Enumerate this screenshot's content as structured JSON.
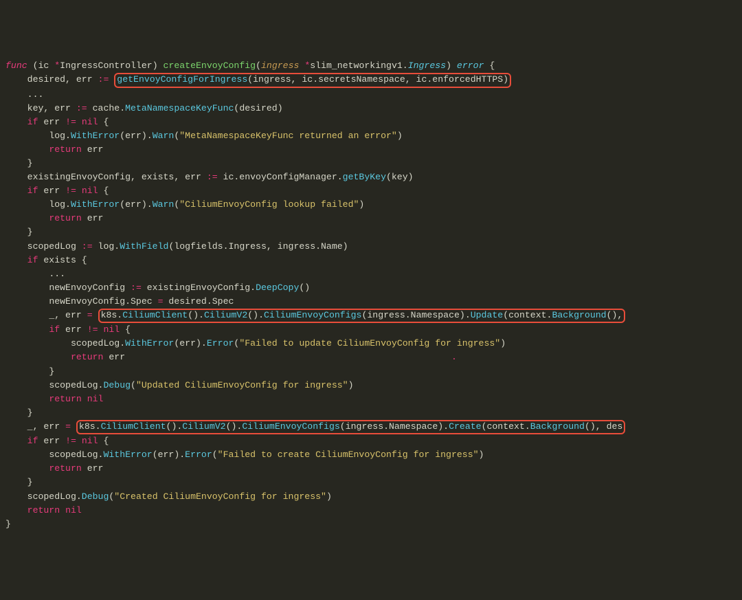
{
  "code": {
    "lines": [
      {
        "indent": 0,
        "segs": [
          {
            "t": "func ",
            "c": "kw"
          },
          {
            "t": "(ic "
          },
          {
            "t": "*",
            "c": "kwni"
          },
          {
            "t": "IngressController) "
          },
          {
            "t": "createEnvoyConfig",
            "c": "fn"
          },
          {
            "t": "("
          },
          {
            "t": "ingress ",
            "c": "arg"
          },
          {
            "t": "*",
            "c": "kwni"
          },
          {
            "t": "slim_networkingv1."
          },
          {
            "t": "Ingress",
            "c": "type"
          },
          {
            "t": ") "
          },
          {
            "t": "error",
            "c": "type"
          },
          {
            "t": " {"
          }
        ]
      },
      {
        "indent": 1,
        "segs": [
          {
            "t": "desired, err "
          },
          {
            "t": ":=",
            "c": "kwni"
          },
          {
            "t": " "
          },
          {
            "hl": true,
            "segs": [
              {
                "t": "getEnvoyConfigForIngress",
                "c": "call"
              },
              {
                "t": "(ingress, ic.secretsNamespace, ic.enforcedHTTPS)"
              }
            ]
          }
        ]
      },
      {
        "indent": 1,
        "segs": [
          {
            "t": "..."
          }
        ]
      },
      {
        "indent": 1,
        "segs": [
          {
            "t": "key, err "
          },
          {
            "t": ":=",
            "c": "kwni"
          },
          {
            "t": " cache."
          },
          {
            "t": "MetaNamespaceKeyFunc",
            "c": "call"
          },
          {
            "t": "(desired)"
          }
        ]
      },
      {
        "indent": 1,
        "segs": [
          {
            "t": "if",
            "c": "kwni"
          },
          {
            "t": " err "
          },
          {
            "t": "!=",
            "c": "kwni"
          },
          {
            "t": " "
          },
          {
            "t": "nil",
            "c": "kwni"
          },
          {
            "t": " {"
          }
        ]
      },
      {
        "indent": 2,
        "segs": [
          {
            "t": "log."
          },
          {
            "t": "WithError",
            "c": "call"
          },
          {
            "t": "(err)."
          },
          {
            "t": "Warn",
            "c": "call"
          },
          {
            "t": "("
          },
          {
            "t": "\"MetaNamespaceKeyFunc returned an error\"",
            "c": "str"
          },
          {
            "t": ")"
          }
        ]
      },
      {
        "indent": 2,
        "segs": [
          {
            "t": "return",
            "c": "kwni"
          },
          {
            "t": " err"
          }
        ]
      },
      {
        "indent": 1,
        "segs": [
          {
            "t": "}"
          }
        ]
      },
      {
        "indent": 1,
        "segs": [
          {
            "t": "existingEnvoyConfig, exists, err "
          },
          {
            "t": ":=",
            "c": "kwni"
          },
          {
            "t": " ic.envoyConfigManager."
          },
          {
            "t": "getByKey",
            "c": "call"
          },
          {
            "t": "(key)"
          }
        ]
      },
      {
        "indent": 1,
        "segs": [
          {
            "t": "if",
            "c": "kwni"
          },
          {
            "t": " err "
          },
          {
            "t": "!=",
            "c": "kwni"
          },
          {
            "t": " "
          },
          {
            "t": "nil",
            "c": "kwni"
          },
          {
            "t": " {"
          }
        ]
      },
      {
        "indent": 2,
        "segs": [
          {
            "t": "log."
          },
          {
            "t": "WithError",
            "c": "call"
          },
          {
            "t": "(err)."
          },
          {
            "t": "Warn",
            "c": "call"
          },
          {
            "t": "("
          },
          {
            "t": "\"CiliumEnvoyConfig lookup failed\"",
            "c": "str"
          },
          {
            "t": ")"
          }
        ]
      },
      {
        "indent": 2,
        "segs": [
          {
            "t": "return",
            "c": "kwni"
          },
          {
            "t": " err"
          }
        ]
      },
      {
        "indent": 1,
        "segs": [
          {
            "t": "}"
          }
        ]
      },
      {
        "indent": 0,
        "segs": [
          {
            "t": ""
          }
        ]
      },
      {
        "indent": 1,
        "segs": [
          {
            "t": "scopedLog "
          },
          {
            "t": ":=",
            "c": "kwni"
          },
          {
            "t": " log."
          },
          {
            "t": "WithField",
            "c": "call"
          },
          {
            "t": "(logfields.Ingress, ingress.Name)"
          }
        ]
      },
      {
        "indent": 1,
        "segs": [
          {
            "t": "if",
            "c": "kwni"
          },
          {
            "t": " exists {"
          }
        ]
      },
      {
        "indent": 2,
        "segs": [
          {
            "t": "..."
          }
        ]
      },
      {
        "indent": 2,
        "segs": [
          {
            "t": "newEnvoyConfig "
          },
          {
            "t": ":=",
            "c": "kwni"
          },
          {
            "t": " existingEnvoyConfig."
          },
          {
            "t": "DeepCopy",
            "c": "call"
          },
          {
            "t": "()"
          }
        ]
      },
      {
        "indent": 2,
        "segs": [
          {
            "t": "newEnvoyConfig.Spec "
          },
          {
            "t": "=",
            "c": "kwni"
          },
          {
            "t": " desired.Spec"
          }
        ]
      },
      {
        "indent": 2,
        "segs": [
          {
            "t": "_, err "
          },
          {
            "t": "=",
            "c": "kwni"
          },
          {
            "t": " "
          },
          {
            "hl": true,
            "segs": [
              {
                "t": "k8s."
              },
              {
                "t": "CiliumClient",
                "c": "call"
              },
              {
                "t": "()."
              },
              {
                "t": "CiliumV2",
                "c": "call"
              },
              {
                "t": "()."
              },
              {
                "t": "CiliumEnvoyConfigs",
                "c": "call"
              },
              {
                "t": "(ingress.Namespace)."
              },
              {
                "t": "Update",
                "c": "call"
              },
              {
                "t": "(context."
              },
              {
                "t": "Background",
                "c": "call"
              },
              {
                "t": "(),"
              }
            ]
          }
        ]
      },
      {
        "indent": 2,
        "segs": [
          {
            "t": "if",
            "c": "kwni"
          },
          {
            "t": " err "
          },
          {
            "t": "!=",
            "c": "kwni"
          },
          {
            "t": " "
          },
          {
            "t": "nil",
            "c": "kwni"
          },
          {
            "t": " {"
          }
        ]
      },
      {
        "indent": 3,
        "segs": [
          {
            "t": "scopedLog."
          },
          {
            "t": "WithError",
            "c": "call"
          },
          {
            "t": "(err)."
          },
          {
            "t": "Error",
            "c": "call"
          },
          {
            "t": "("
          },
          {
            "t": "\"Failed to update CiliumEnvoyConfig for ingress\"",
            "c": "str"
          },
          {
            "t": ")"
          }
        ]
      },
      {
        "indent": 3,
        "segs": [
          {
            "t": "return",
            "c": "kwni"
          },
          {
            "t": " err                                                            "
          },
          {
            "t": ".",
            "c": "curs"
          }
        ]
      },
      {
        "indent": 2,
        "segs": [
          {
            "t": "}"
          }
        ]
      },
      {
        "indent": 2,
        "segs": [
          {
            "t": "scopedLog."
          },
          {
            "t": "Debug",
            "c": "call"
          },
          {
            "t": "("
          },
          {
            "t": "\"Updated CiliumEnvoyConfig for ingress\"",
            "c": "str"
          },
          {
            "t": ")"
          }
        ]
      },
      {
        "indent": 2,
        "segs": [
          {
            "t": "return",
            "c": "kwni"
          },
          {
            "t": " "
          },
          {
            "t": "nil",
            "c": "kwni"
          }
        ]
      },
      {
        "indent": 1,
        "segs": [
          {
            "t": "}"
          }
        ]
      },
      {
        "indent": 1,
        "segs": [
          {
            "t": "_, err "
          },
          {
            "t": "=",
            "c": "kwni"
          },
          {
            "t": " "
          },
          {
            "hl": true,
            "segs": [
              {
                "t": "k8s."
              },
              {
                "t": "CiliumClient",
                "c": "call"
              },
              {
                "t": "()."
              },
              {
                "t": "CiliumV2",
                "c": "call"
              },
              {
                "t": "()."
              },
              {
                "t": "CiliumEnvoyConfigs",
                "c": "call"
              },
              {
                "t": "(ingress.Namespace)."
              },
              {
                "t": "Create",
                "c": "call"
              },
              {
                "t": "(context."
              },
              {
                "t": "Background",
                "c": "call"
              },
              {
                "t": "(), des"
              }
            ]
          }
        ]
      },
      {
        "indent": 1,
        "segs": [
          {
            "t": "if",
            "c": "kwni"
          },
          {
            "t": " err "
          },
          {
            "t": "!=",
            "c": "kwni"
          },
          {
            "t": " "
          },
          {
            "t": "nil",
            "c": "kwni"
          },
          {
            "t": " {"
          }
        ]
      },
      {
        "indent": 2,
        "segs": [
          {
            "t": "scopedLog."
          },
          {
            "t": "WithError",
            "c": "call"
          },
          {
            "t": "(err)."
          },
          {
            "t": "Error",
            "c": "call"
          },
          {
            "t": "("
          },
          {
            "t": "\"Failed to create CiliumEnvoyConfig for ingress\"",
            "c": "str"
          },
          {
            "t": ")"
          }
        ]
      },
      {
        "indent": 2,
        "segs": [
          {
            "t": "return",
            "c": "kwni"
          },
          {
            "t": " err"
          }
        ]
      },
      {
        "indent": 1,
        "segs": [
          {
            "t": "}"
          }
        ]
      },
      {
        "indent": 1,
        "segs": [
          {
            "t": "scopedLog."
          },
          {
            "t": "Debug",
            "c": "call"
          },
          {
            "t": "("
          },
          {
            "t": "\"Created CiliumEnvoyConfig for ingress\"",
            "c": "str"
          },
          {
            "t": ")"
          }
        ]
      },
      {
        "indent": 1,
        "segs": [
          {
            "t": "return",
            "c": "kwni"
          },
          {
            "t": " "
          },
          {
            "t": "nil",
            "c": "kwni"
          }
        ]
      },
      {
        "indent": 0,
        "segs": [
          {
            "t": "}"
          }
        ]
      }
    ]
  }
}
